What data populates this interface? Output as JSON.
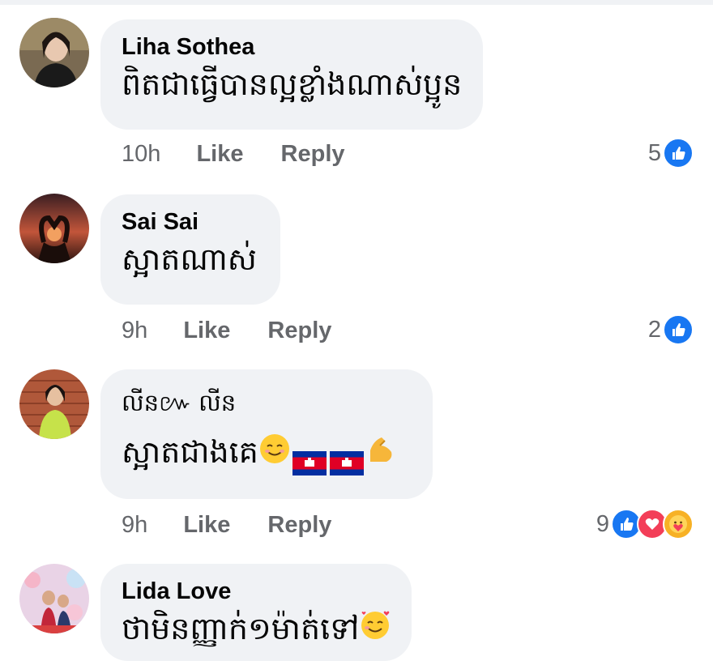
{
  "comments": [
    {
      "author": "Liha Sothea",
      "text": "ពិតជាធ្វើបានល្អខ្លាំងណាស់ប្អូន",
      "time": "10h",
      "like_label": "Like",
      "reply_label": "Reply",
      "reaction_count": "5",
      "reactions": [
        "like"
      ]
    },
    {
      "author": "Sai Sai",
      "text": "ស្អាតណាស់",
      "time": "9h",
      "like_label": "Like",
      "reply_label": "Reply",
      "reaction_count": "2",
      "reactions": [
        "like"
      ]
    },
    {
      "author": "លីន៚ លីន",
      "text": "ស្អាតជាងគេ",
      "emojis": [
        "smiling-face-emoji",
        "cambodia-flag-emoji",
        "cambodia-flag-emoji",
        "flexed-biceps-emoji"
      ],
      "time": "9h",
      "like_label": "Like",
      "reply_label": "Reply",
      "reaction_count": "9",
      "reactions": [
        "like",
        "love",
        "care"
      ]
    },
    {
      "author": "Lida Love",
      "text": "ថាមិនញ្ញាក់១ម៉ាត់ទៅ",
      "emojis": [
        "smiling-face-with-hearts-emoji"
      ],
      "time": "",
      "like_label": "",
      "reply_label": "",
      "reaction_count": ""
    }
  ],
  "colors": {
    "bubble": "#f0f2f5",
    "meta_text": "#65676b",
    "like_blue": "#1877f2",
    "love_red": "#f33e58",
    "care_yellow": "#f7b125"
  }
}
